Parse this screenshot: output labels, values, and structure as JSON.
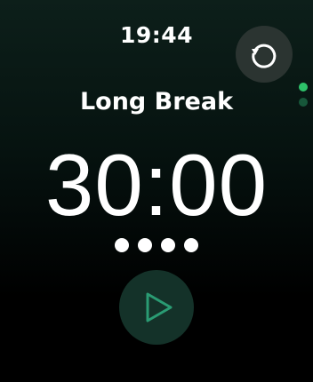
{
  "status_bar": {
    "time": "19:44"
  },
  "reset": {
    "icon": "reset-icon",
    "icon_color": "#ffffff"
  },
  "page_indicator": {
    "dots": [
      {
        "state": "active",
        "color": "#2ec26a"
      },
      {
        "state": "inactive",
        "color": "#17573a"
      }
    ]
  },
  "timer": {
    "session_title": "Long Break",
    "remaining": "30:00",
    "session_dots": [
      {
        "color": "#ffffff"
      },
      {
        "color": "#ffffff"
      },
      {
        "color": "#ffffff"
      },
      {
        "color": "#ffffff"
      }
    ]
  },
  "play": {
    "icon": "play-icon",
    "icon_color": "#2a9b73"
  }
}
